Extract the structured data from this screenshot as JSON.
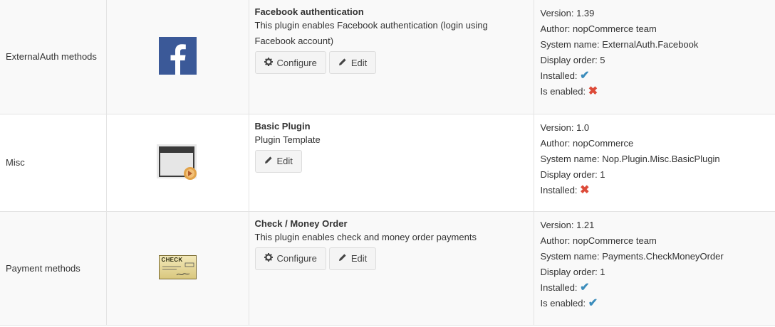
{
  "rows": [
    {
      "group": "ExternalAuth methods",
      "logo": "facebook-logo",
      "name": "Facebook authentication",
      "description": "This plugin enables Facebook authentication (login using Facebook account)",
      "buttons": {
        "configure": "Configure",
        "edit": "Edit"
      },
      "meta": {
        "version": "Version: 1.39",
        "author": "Author: nopCommerce team",
        "system_name": "System name: ExternalAuth.Facebook",
        "display_order": "Display order: 5",
        "installed_label": "Installed:",
        "installed_icon": "check-icon",
        "enabled_label": "Is enabled:",
        "enabled_icon": "cross-icon"
      }
    },
    {
      "group": "Misc",
      "logo": "basic-plugin-logo",
      "name": "Basic Plugin",
      "description": "Plugin Template",
      "buttons": {
        "edit": "Edit"
      },
      "meta": {
        "version": "Version: 1.0",
        "author": "Author: nopCommerce",
        "system_name": "System name: Nop.Plugin.Misc.BasicPlugin",
        "display_order": "Display order: 1",
        "installed_label": "Installed:",
        "installed_icon": "cross-icon"
      }
    },
    {
      "group": "Payment methods",
      "logo": "check-money-order-logo",
      "logo_text": "CHECK",
      "name": "Check / Money Order",
      "description": "This plugin enables check and money order payments",
      "buttons": {
        "configure": "Configure",
        "edit": "Edit"
      },
      "meta": {
        "version": "Version: 1.21",
        "author": "Author: nopCommerce team",
        "system_name": "System name: Payments.CheckMoneyOrder",
        "display_order": "Display order: 1",
        "installed_label": "Installed:",
        "installed_icon": "check-icon",
        "enabled_label": "Is enabled:",
        "enabled_icon": "check-icon"
      }
    }
  ],
  "colors": {
    "check": "#3c8dbc",
    "cross": "#dd4b39",
    "facebook": "#3b5998"
  }
}
